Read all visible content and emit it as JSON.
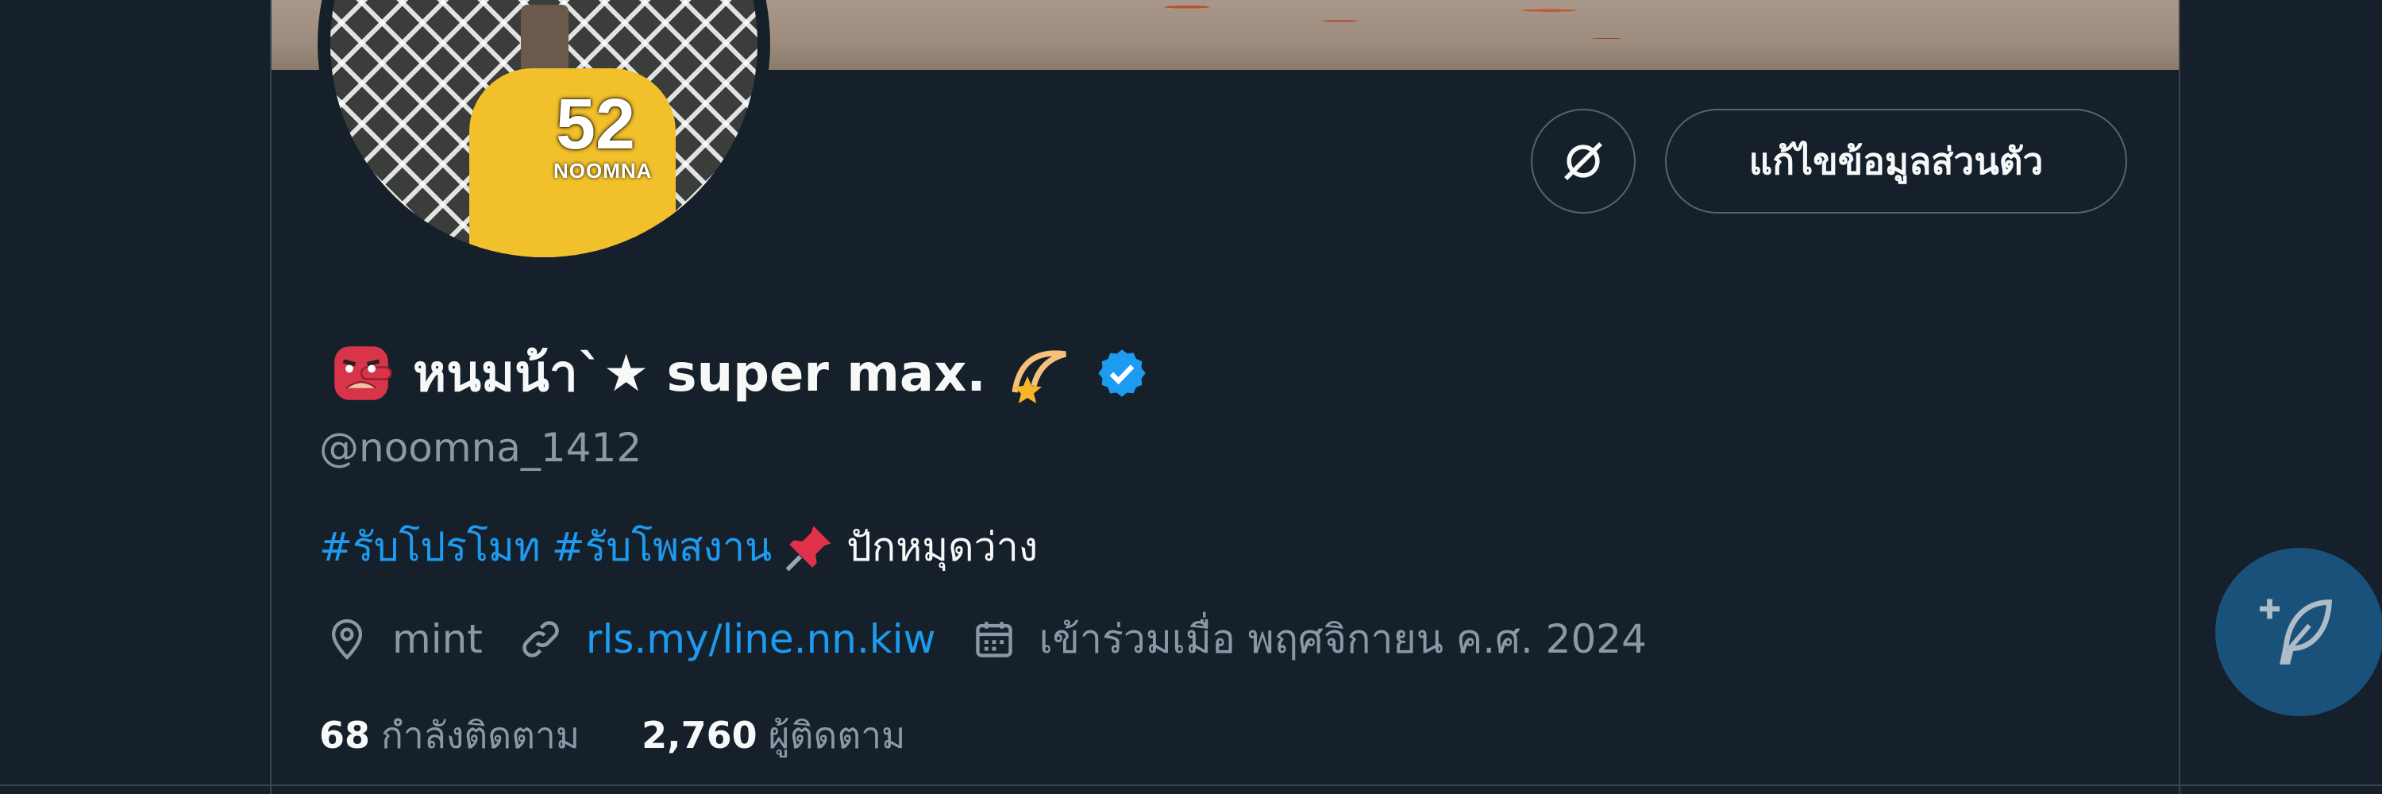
{
  "avatar": {
    "number": "52",
    "tag": "NOOMNA"
  },
  "actions": {
    "edit_profile_label": "แก้ไขข้อมูลส่วนตัว"
  },
  "profile": {
    "display_name": "หนมน้า`★ super max.",
    "handle": "@noomna_1412",
    "verified": true
  },
  "bio": {
    "hashtags": [
      "#รับโปรโมท",
      "#รับโพสงาน"
    ],
    "text": "ปักหมุดว่าง"
  },
  "meta": {
    "location": "mint",
    "link": "rls.my/line.nn.kiw",
    "joined": "เข้าร่วมเมื่อ พฤศจิกายน ค.ศ. 2024"
  },
  "stats": {
    "following_count": "68",
    "following_label": "กำลังติดตาม",
    "followers_count": "2,760",
    "followers_label": "ผู้ติดตาม"
  },
  "colors": {
    "accent": "#1d9bf0",
    "background": "#15202b",
    "muted": "#8b98a5"
  }
}
